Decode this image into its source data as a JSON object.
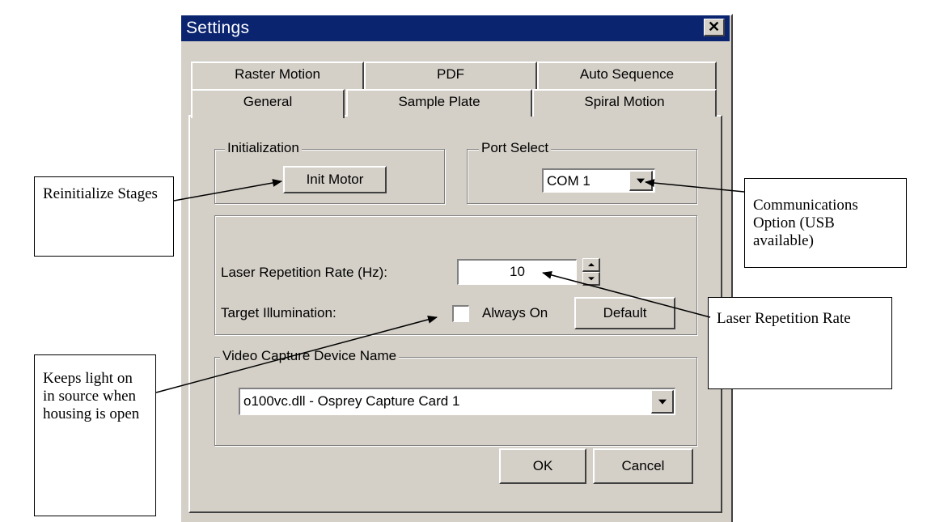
{
  "window": {
    "title": "Settings",
    "close_glyph": "✕"
  },
  "tabs": {
    "back_row": [
      "Raster Motion",
      "PDF",
      "Auto Sequence"
    ],
    "front_row": [
      "General",
      "Sample Plate",
      "Spiral Motion"
    ],
    "selected": "General"
  },
  "initialization": {
    "legend": "Initialization",
    "init_motor_label": "Init Motor"
  },
  "port_select": {
    "legend": "Port Select",
    "value": "COM 1"
  },
  "laser": {
    "rate_label": "Laser Repetition Rate (Hz):",
    "rate_value": "10",
    "illumination_label": "Target Illumination:",
    "always_on_label": "Always On",
    "always_on_checked": false,
    "default_label": "Default"
  },
  "video": {
    "legend": "Video Capture Device Name",
    "device_value": "o100vc.dll - Osprey Capture Card 1"
  },
  "footer": {
    "ok_label": "OK",
    "cancel_label": "Cancel"
  },
  "annotations": {
    "reinitialize": "Reinitialize Stages",
    "communications": "Communications Option (USB available)",
    "laser_rate": "Laser Repetition Rate",
    "keeps_light": "Keeps light on in source when housing is open"
  },
  "icons": {
    "close": "close-icon",
    "dropdown": "chevron-down-icon",
    "spin_up": "spin-up-icon",
    "spin_down": "spin-down-icon",
    "checkbox": "checkbox-icon"
  },
  "colors": {
    "title_bar": "#0a2470",
    "dialog_face": "#d4d0c8"
  }
}
